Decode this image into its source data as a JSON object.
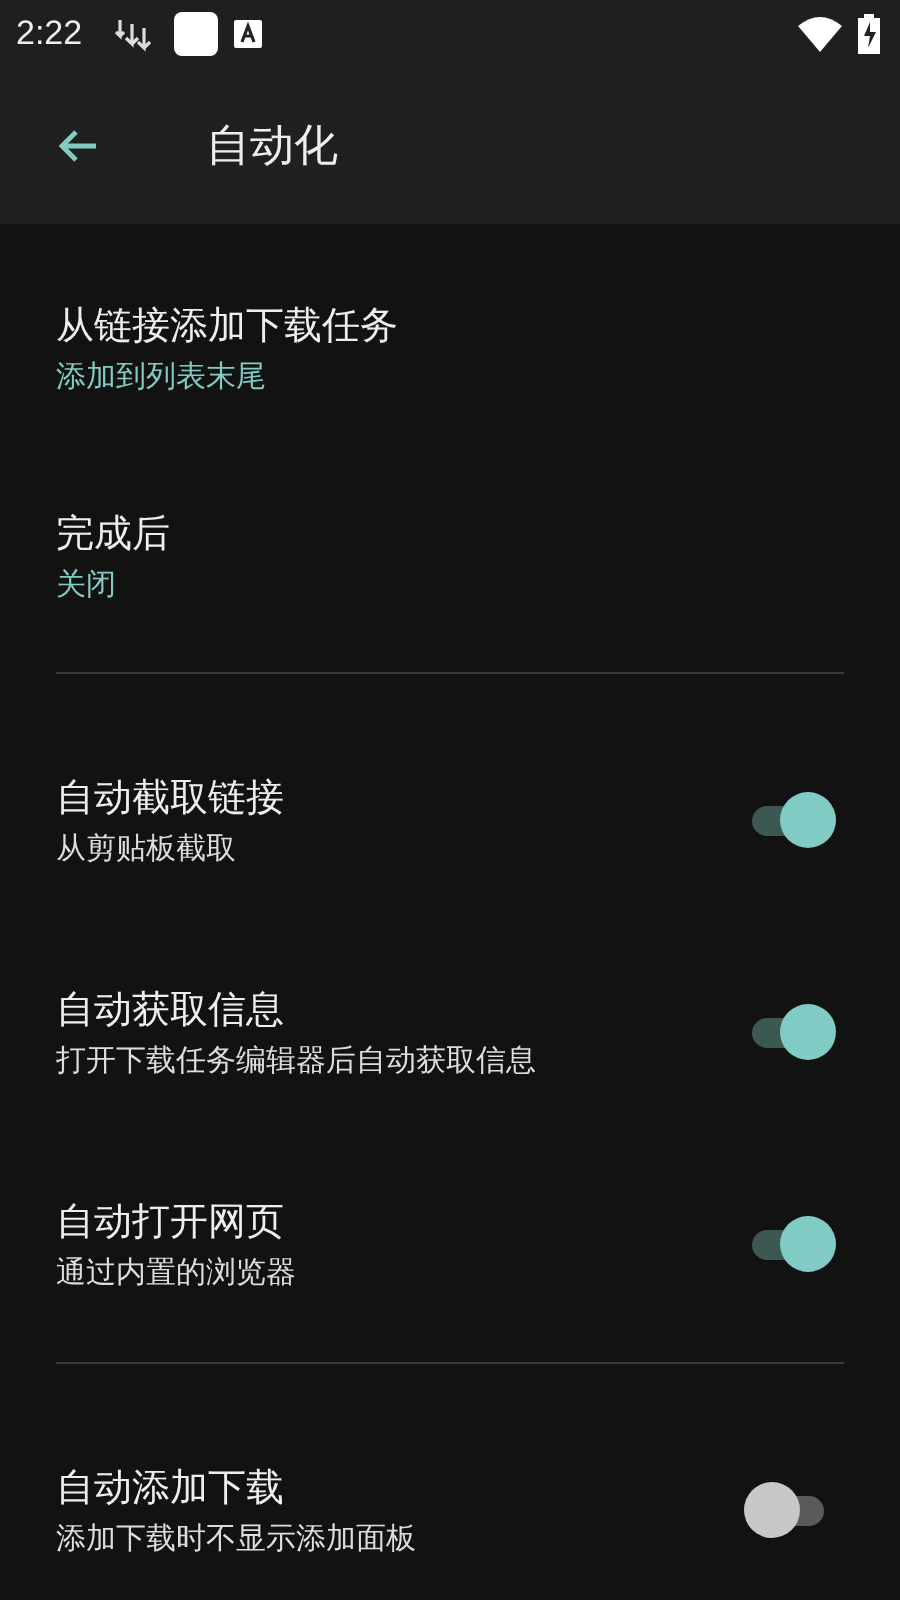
{
  "status_bar": {
    "time": "2:22"
  },
  "app_bar": {
    "title": "自动化"
  },
  "sections": [
    {
      "items": [
        {
          "kind": "choice",
          "title": "从链接添加下载任务",
          "summary": "添加到列表末尾"
        },
        {
          "kind": "choice",
          "title": "完成后",
          "summary": "关闭"
        }
      ]
    },
    {
      "items": [
        {
          "kind": "switch",
          "title": "自动截取链接",
          "summary": "从剪贴板截取",
          "on": true
        },
        {
          "kind": "switch",
          "title": "自动获取信息",
          "summary": "打开下载任务编辑器后自动获取信息",
          "on": true
        },
        {
          "kind": "switch",
          "title": "自动打开网页",
          "summary": "通过内置的浏览器",
          "on": true
        }
      ]
    },
    {
      "items": [
        {
          "kind": "switch",
          "title": "自动添加下载",
          "summary": "添加下载时不显示添加面板",
          "on": false
        }
      ]
    }
  ]
}
